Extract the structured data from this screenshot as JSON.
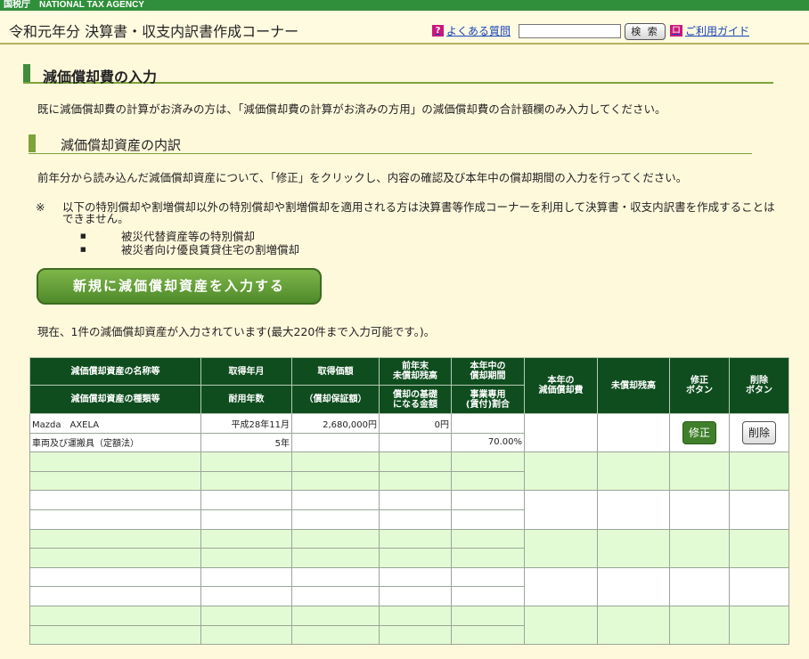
{
  "header": {
    "agency": "国税庁　NATIONAL TAX AGENCY",
    "title": "令和元年分 決算書・収支内訳書作成コーナー",
    "faq_label": "よくある質問",
    "faq_icon": "?",
    "search_value": "",
    "search_button": "検 索",
    "guide_label": "ご利用ガイド",
    "guide_icon": "ロ"
  },
  "section": {
    "heading": "減価償却費の入力",
    "intro": "既に減価償却費の計算がお済みの方は、「減価償却費の計算がお済みの方用」の減価償却費の合計額欄のみ入力してください。",
    "subheading": "減価償却資産の内訳",
    "description": "前年分から読み込んだ減価償却資産について、「修正」をクリックし、内容の確認及び本年中の償却期間の入力を行ってください。",
    "note_mark": "※",
    "note_text": "以下の特別償却や割増償却以外の特別償却や割増償却を適用される方は決算書等作成コーナーを利用して決算書・収支内訳書を作成することはできません。",
    "bullets": [
      "被災代替資産等の特別償却",
      "被災者向け優良賃貸住宅の割増償却"
    ],
    "new_button": "新規に減価償却資産を入力する",
    "count_text": "現在、1件の減価償却資産が入力されています(最大220件まで入力可能です。)。"
  },
  "table": {
    "headers": {
      "name": "減価償却資産の名称等",
      "kind": "減価償却資産の種類等",
      "acq_date": "取得年月",
      "life": "耐用年数",
      "acq_price": "取得価額",
      "guarantee": "（償却保証額）",
      "prev_balance": "前年末\n未償却残高",
      "basis": "償却の基礎\nになる金額",
      "period": "本年中の\n償却期間",
      "business_ratio": "事業専用\n(賃付)割合",
      "depreciation": "本年の\n減価償却費",
      "unamortized": "未償却残高",
      "edit": "修正\nボタン",
      "delete": "削除\nボタン"
    },
    "rows": [
      {
        "name": "Mazda　AXELA",
        "kind": "車両及び運搬具（定額法）",
        "acq_date": "平成28年11月",
        "life": "5年",
        "acq_price": "2,680,000円",
        "guarantee": "",
        "prev_balance": "0円",
        "basis": "",
        "period": "",
        "business_ratio": "70.00%",
        "depreciation": "",
        "unamortized": "",
        "edit_label": "修正",
        "delete_label": "削除"
      }
    ],
    "empty_rows": 5
  }
}
